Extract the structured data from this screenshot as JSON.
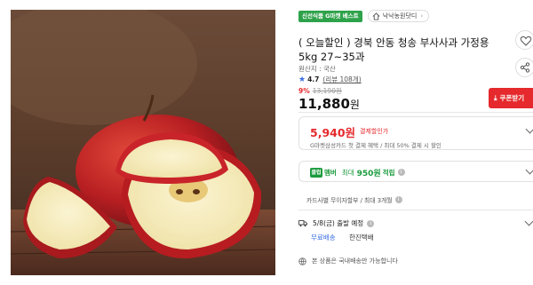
{
  "top_strip": {
    "fragments": [
      "",
      "",
      ""
    ]
  },
  "product": {
    "image_alt_icon": "apple-product-photo",
    "badge": "신선식품 G마켓 베스트",
    "seller": "낙낙농원닷디",
    "title": "( 오늘할인 ) 경북 안동 청송 부사사과 가정용 5kg 27~35과",
    "origin": "원산지 : 국산",
    "rating": "4.7",
    "reviews": "(리뷰 108개)",
    "discount_pct": "9%",
    "original_price": "13,190원",
    "price": "11,880",
    "price_unit": "원",
    "coupon_label": "쿠폰받기"
  },
  "offers": {
    "discount_price": "5,940원",
    "discount_label": "결제할인가",
    "discount_note": "G마켓삼성카드 첫 결제 혜택 / 최대 50% 결제 시 할인",
    "club_badge": "클럽",
    "club_name": "멤버",
    "points_max": "최대",
    "points_value": "950원",
    "points_suffix": "적립",
    "installment": "카드사별 무이자할부 / 최대 3개월"
  },
  "shipping": {
    "date": "5/8(금) 출발 예정",
    "free": "무료배송",
    "carrier": "한진택배",
    "notice": "본 상품은 국내배송만 가능합니다"
  },
  "colors": {
    "accent_red": "#e5292c",
    "green": "#1b9b3d",
    "blue": "#3a6fe0"
  }
}
